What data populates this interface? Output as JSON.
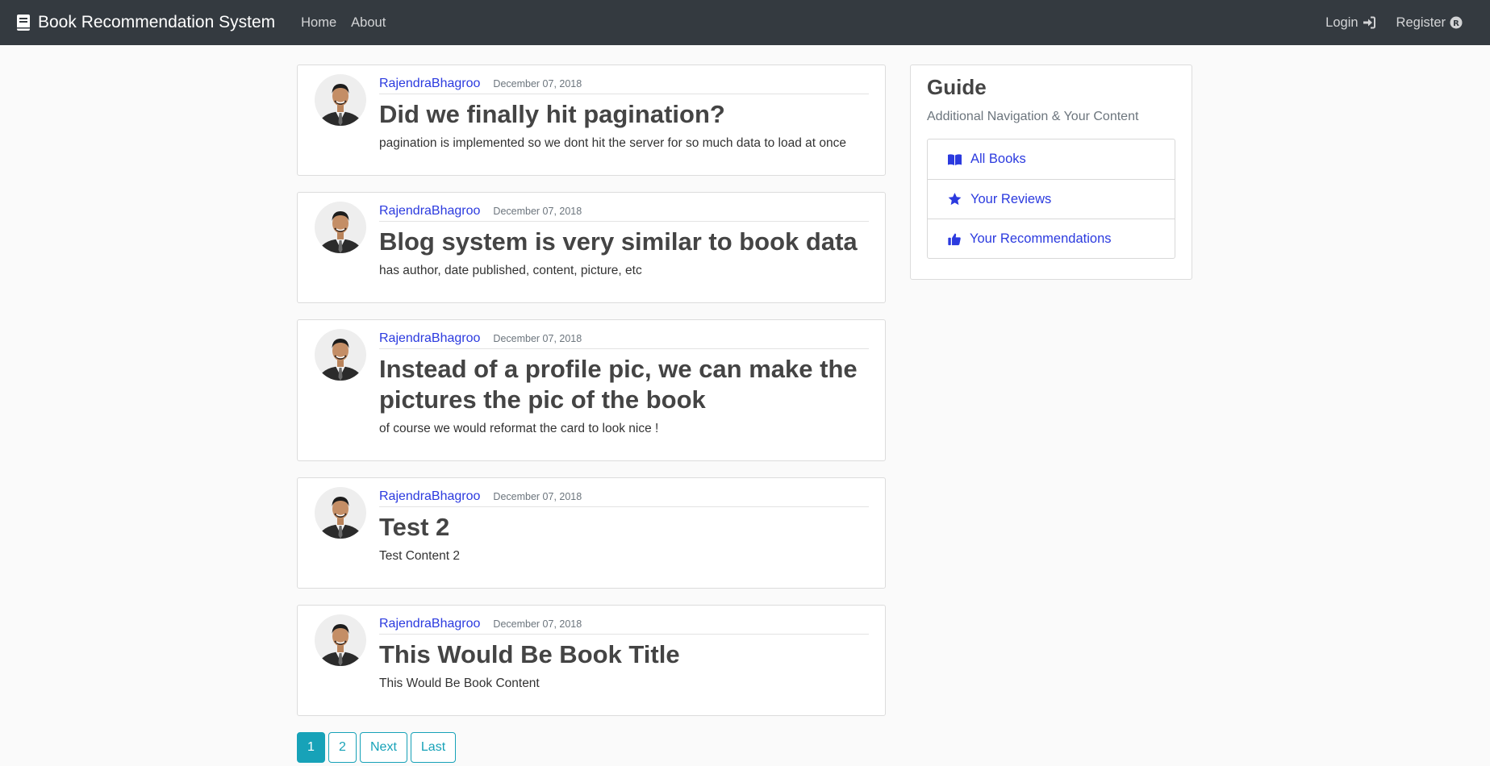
{
  "nav": {
    "brand": "Book Recommendation System",
    "links": [
      "Home",
      "About"
    ],
    "login": "Login",
    "register": "Register"
  },
  "posts": [
    {
      "author": "RajendraBhagroo",
      "date": "December 07, 2018",
      "title": "Did we finally hit pagination?",
      "content": "pagination is implemented so we dont hit the server for so much data to load at once"
    },
    {
      "author": "RajendraBhagroo",
      "date": "December 07, 2018",
      "title": "Blog system is very similar to book data",
      "content": "has author, date published, content, picture, etc"
    },
    {
      "author": "RajendraBhagroo",
      "date": "December 07, 2018",
      "title": "Instead of a profile pic, we can make the pictures the pic of the book",
      "content": "of course we would reformat the card to look nice !"
    },
    {
      "author": "RajendraBhagroo",
      "date": "December 07, 2018",
      "title": "Test 2",
      "content": "Test Content 2"
    },
    {
      "author": "RajendraBhagroo",
      "date": "December 07, 2018",
      "title": "This Would Be Book Title",
      "content": "This Would Be Book Content"
    }
  ],
  "pagination": [
    "1",
    "2",
    "Next",
    "Last"
  ],
  "guide": {
    "title": "Guide",
    "subtitle": "Additional Navigation & Your Content",
    "items": [
      {
        "label": "All Books",
        "icon": "book-open-icon"
      },
      {
        "label": "Your Reviews",
        "icon": "star-icon"
      },
      {
        "label": "Your Recommendations",
        "icon": "thumbs-up-icon"
      }
    ]
  },
  "colors": {
    "navbar": "#343a40",
    "link": "#2b3adf",
    "accent": "#17a2b8"
  }
}
